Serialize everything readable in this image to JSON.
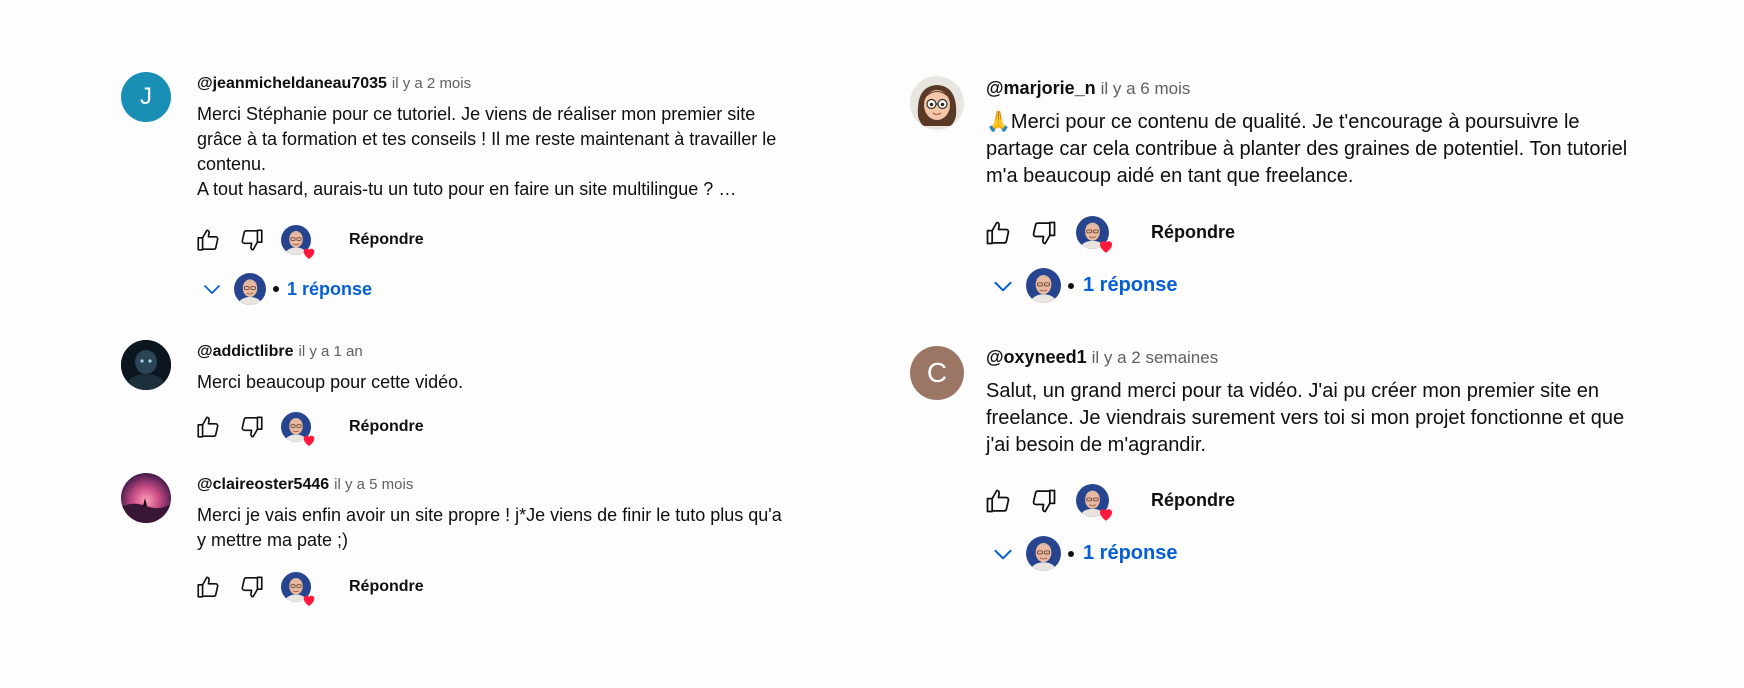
{
  "colors": {
    "link_blue": "#065fd4",
    "meta_gray": "#606060",
    "avatar_j": "#1a8fb5",
    "avatar_c": "#9c7665",
    "heart": "#ff1a3c"
  },
  "left_comments": [
    {
      "avatar_letter": "J",
      "author": "@jeanmicheldaneau7035",
      "time": "il y a 2 mois",
      "lines": [
        "Merci Stéphanie pour ce tutoriel. Je viens de réaliser mon premier site",
        "grâce à ta formation et tes conseils ! Il me reste maintenant à travailler le",
        "contenu.",
        "A tout hasard, aurais-tu un tuto pour en faire un site multilingue ? …"
      ],
      "reply_label": "Répondre",
      "replies_label": "1 réponse"
    },
    {
      "author": "@addictlibre",
      "time": "il y a 1 an",
      "lines": [
        "Merci beaucoup pour cette vidéo."
      ],
      "reply_label": "Répondre"
    },
    {
      "author": "@claireoster5446",
      "time": "il y a 5 mois",
      "lines": [
        "Merci je vais enfin avoir un site propre ! j*Je viens de finir le tuto plus qu'a",
        "y mettre ma pate ;)"
      ],
      "reply_label": "Répondre"
    }
  ],
  "right_comments": [
    {
      "author": "@marjorie_n",
      "time": "il y a 6 mois",
      "lines": [
        "🙏Merci pour ce contenu de qualité. Je t'encourage à poursuivre le",
        "partage car cela contribue à planter des graines de potentiel. Ton tutoriel",
        "m'a beaucoup aidé en tant que freelance."
      ],
      "reply_label": "Répondre",
      "replies_label": "1 réponse"
    },
    {
      "avatar_letter": "C",
      "author": "@oxyneed1",
      "time": "il y a 2 semaines",
      "lines": [
        "Salut, un grand merci pour ta vidéo. J'ai pu créer mon premier site en",
        "freelance. Je viendrais surement vers toi si mon projet fonctionne et que",
        "j'ai besoin de m'agrandir."
      ],
      "reply_label": "Répondre",
      "replies_label": "1 réponse"
    }
  ]
}
